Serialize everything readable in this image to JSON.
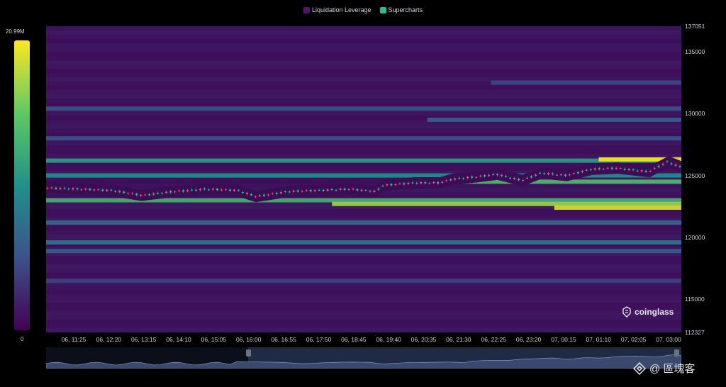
{
  "legend": [
    {
      "label": "Liquidation Leverage",
      "color": "#4a1665"
    },
    {
      "label": "Supercharts",
      "color": "#2fb890"
    }
  ],
  "color_scale": {
    "max_label": "20.99M",
    "min_label": "0"
  },
  "brand": "coinglass",
  "watermark": "@ 區塊客",
  "colors": {
    "low": "#440154",
    "mid": "#21918c",
    "high": "#fde725",
    "up_candle": "#20c997",
    "down_candle": "#f0506e"
  },
  "chart_data": {
    "type": "heatmap",
    "title": "",
    "xlabel": "",
    "ylabel": "",
    "ylim": [
      112327,
      137051
    ],
    "y_ticks": [
      "137051",
      "135000",
      "130000",
      "125000",
      "120000",
      "115000",
      "112327"
    ],
    "x_ticks": [
      "06, 11:25",
      "06, 12:20",
      "06, 13:15",
      "06, 14:10",
      "06, 15:05",
      "06, 16:00",
      "06, 16:55",
      "06, 17:50",
      "06, 18:45",
      "06, 19:40",
      "06, 20:35",
      "06, 21:30",
      "06, 22:25",
      "06, 23:20",
      "07, 00:15",
      "07, 01:10",
      "07, 02:05",
      "07, 03:00"
    ],
    "liquidation_bands": [
      {
        "price": 126200,
        "intensity": 0.55,
        "from": 0.0,
        "to": 1.0
      },
      {
        "price": 126300,
        "intensity": 1.0,
        "from": 0.87,
        "to": 1.0
      },
      {
        "price": 125000,
        "intensity": 0.5,
        "from": 0.0,
        "to": 1.0
      },
      {
        "price": 124500,
        "intensity": 0.7,
        "from": 0.55,
        "to": 1.0
      },
      {
        "price": 123000,
        "intensity": 0.65,
        "from": 0.0,
        "to": 1.0
      },
      {
        "price": 122700,
        "intensity": 0.85,
        "from": 0.45,
        "to": 1.0
      },
      {
        "price": 122400,
        "intensity": 0.95,
        "from": 0.8,
        "to": 1.0
      },
      {
        "price": 121200,
        "intensity": 0.35,
        "from": 0.0,
        "to": 1.0
      },
      {
        "price": 119600,
        "intensity": 0.4,
        "from": 0.0,
        "to": 1.0
      },
      {
        "price": 118900,
        "intensity": 0.3,
        "from": 0.0,
        "to": 1.0
      },
      {
        "price": 128000,
        "intensity": 0.25,
        "from": 0.0,
        "to": 1.0
      },
      {
        "price": 129500,
        "intensity": 0.3,
        "from": 0.6,
        "to": 1.0
      },
      {
        "price": 130400,
        "intensity": 0.25,
        "from": 0.0,
        "to": 1.0
      },
      {
        "price": 132500,
        "intensity": 0.22,
        "from": 0.7,
        "to": 1.0
      },
      {
        "price": 116500,
        "intensity": 0.2,
        "from": 0.0,
        "to": 1.0
      }
    ],
    "price_series": {
      "x": [
        0,
        0.05,
        0.1,
        0.15,
        0.2,
        0.25,
        0.3,
        0.33,
        0.38,
        0.43,
        0.48,
        0.52,
        0.53,
        0.58,
        0.62,
        0.64,
        0.68,
        0.71,
        0.75,
        0.78,
        0.82,
        0.86,
        0.9,
        0.95,
        0.98,
        1.0
      ],
      "y": [
        124000,
        123900,
        123800,
        123400,
        123700,
        123900,
        123800,
        123300,
        123700,
        123800,
        123900,
        123700,
        124200,
        124400,
        124400,
        124700,
        124900,
        125100,
        124600,
        125200,
        125000,
        125500,
        125600,
        125300,
        126100,
        125700
      ]
    }
  }
}
